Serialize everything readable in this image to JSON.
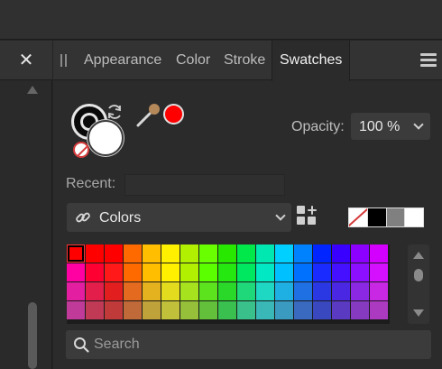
{
  "left_panel": {
    "close_icon": "close-icon"
  },
  "tabs": [
    {
      "label": "Appearance",
      "active": false
    },
    {
      "label": "Color",
      "active": false
    },
    {
      "label": "Stroke",
      "active": false
    },
    {
      "label": "Swatches",
      "active": true
    }
  ],
  "icons": {
    "grip": "grip-icon",
    "menu": "hamburger-menu-icon",
    "swap": "swap-arrows-icon",
    "picker": "eyedropper-icon",
    "link": "link-icon",
    "add_palette": "add-palette-icon",
    "search": "search-icon"
  },
  "current_color": "#ff0000",
  "opacity": {
    "label": "Opacity:",
    "value": "100 %"
  },
  "recent": {
    "label": "Recent:"
  },
  "palette_select": {
    "value": "Colors"
  },
  "quick_swatches": [
    "none",
    "#000000",
    "#808080",
    "#ffffff"
  ],
  "swatch_rows": [
    [
      "#ff0000",
      "#ff0000",
      "#ff0000",
      "#ff6a00",
      "#ffbf00",
      "#fff000",
      "#b0f000",
      "#6aff00",
      "#28e800",
      "#00e84a",
      "#00e8b2",
      "#00d0ff",
      "#0082ff",
      "#0025ff",
      "#3a00ff",
      "#8c00ff",
      "#d400ff"
    ],
    [
      "#ff00a2",
      "#ff0033",
      "#ff1919",
      "#ff6a00",
      "#ffbf00",
      "#fff000",
      "#b0f000",
      "#5cff00",
      "#24e810",
      "#00e860",
      "#00e8c4",
      "#00c0ff",
      "#0070ff",
      "#1a2bff",
      "#4410ff",
      "#8c10ff",
      "#d410ff"
    ],
    [
      "#e31ea0",
      "#e31e4a",
      "#e31e1e",
      "#e36a1e",
      "#e3b21e",
      "#e3dc1e",
      "#a6e31e",
      "#5ce31e",
      "#2ad82a",
      "#1ed87a",
      "#1ed8c4",
      "#1eb0e3",
      "#1e70e3",
      "#2a38e3",
      "#4a28e3",
      "#8a28e3",
      "#c828e3"
    ],
    [
      "#c03a9a",
      "#c03a55",
      "#c03a3a",
      "#c06a3a",
      "#c0a23a",
      "#c0c03a",
      "#96c03a",
      "#62c03a",
      "#3ac04e",
      "#3ac08a",
      "#3ab8b8",
      "#3a9ac0",
      "#3a6ac0",
      "#3a48c0",
      "#5a3ac0",
      "#863ac0",
      "#ac3ac0"
    ]
  ],
  "selected_swatch": {
    "row": 0,
    "col": 0
  },
  "search": {
    "placeholder": "Search",
    "value": ""
  }
}
